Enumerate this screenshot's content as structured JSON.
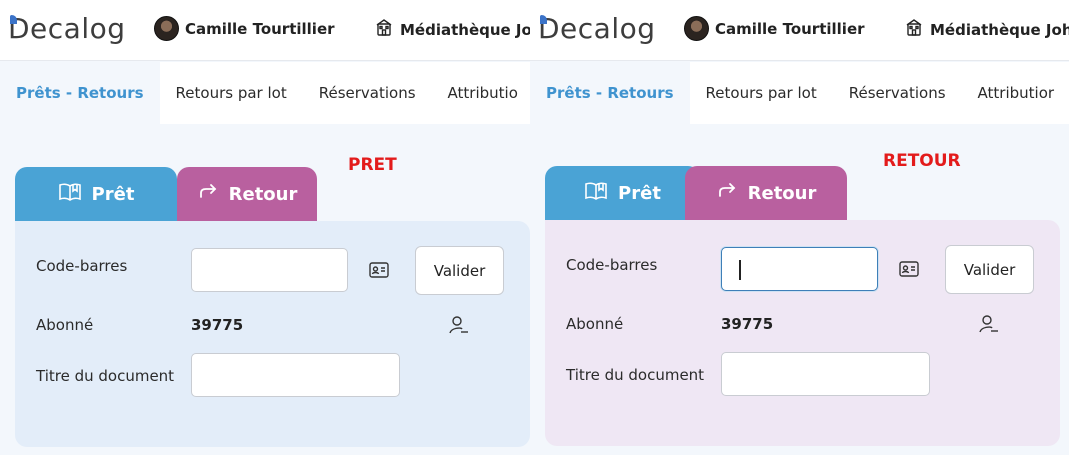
{
  "panels": [
    {
      "header": {
        "logo": "Decalog",
        "user": "Camille Tourtillier",
        "library": "Médiathèque Joh"
      },
      "nav": {
        "tabs": [
          "Prêts - Retours",
          "Retours par lot",
          "Réservations",
          "Attributio"
        ]
      },
      "mode_label": "PRET",
      "buttons": {
        "pret": "Prêt",
        "retour": "Retour"
      },
      "form": {
        "barcode_label": "Code-barres",
        "barcode_value": "",
        "valider": "Valider",
        "subscriber_label": "Abonné",
        "subscriber_value": "39775",
        "title_label": "Titre du document",
        "title_value": ""
      }
    },
    {
      "header": {
        "logo": "Decalog",
        "user": "Camille Tourtillier",
        "library": "Médiathèque Johr"
      },
      "nav": {
        "tabs": [
          "Prêts - Retours",
          "Retours par lot",
          "Réservations",
          "Attributior"
        ]
      },
      "mode_label": "RETOUR",
      "buttons": {
        "pret": "Prêt",
        "retour": "Retour"
      },
      "form": {
        "barcode_label": "Code-barres",
        "barcode_value": "",
        "valider": "Valider",
        "subscriber_label": "Abonné",
        "subscriber_value": "39775",
        "title_label": "Titre du document",
        "title_value": ""
      }
    }
  ],
  "colors": {
    "pret_blue": "#4aa3d5",
    "retour_purple": "#b9609f",
    "active_tab_text": "#3f93cf",
    "mode_label_red": "#e31b1b",
    "card_pret": "#e3edf9",
    "card_retour": "#efe7f4"
  },
  "icons": [
    "avatar",
    "building-icon",
    "book-open-icon",
    "return-arrow-icon",
    "id-card-icon",
    "user-remove-icon"
  ]
}
